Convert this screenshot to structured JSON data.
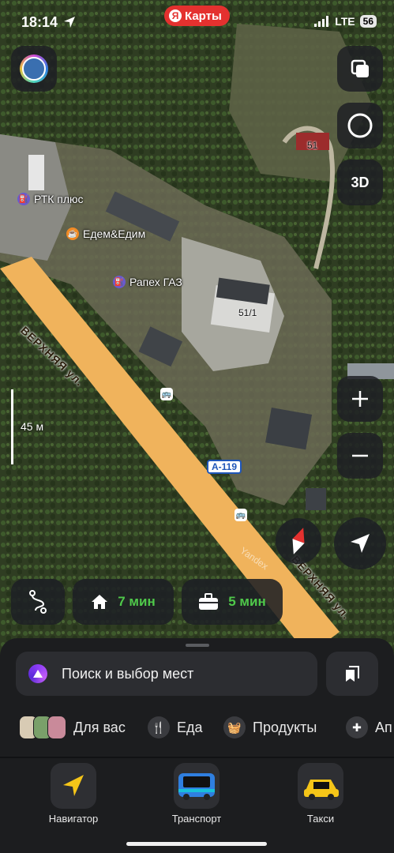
{
  "status_bar": {
    "time": "18:14",
    "network": "LTE",
    "battery": "56"
  },
  "app_badge": {
    "logo": "Я",
    "name": "Карты"
  },
  "map": {
    "pois": [
      {
        "name": "РТК плюс",
        "icon": "fuel-icon"
      },
      {
        "name": "Едем&Едим",
        "icon": "cafe-icon"
      },
      {
        "name": "Рапех ГАЗ",
        "icon": "fuel-icon"
      }
    ],
    "buildings": [
      "51",
      "51/1"
    ],
    "streets": [
      "ВЕРХНЯЯ ул.",
      "ВЕРХНЯЯ ул."
    ],
    "road_shield": "А-119",
    "scale_label": "45 м",
    "watermark": "Yandex"
  },
  "controls": {
    "three_d_label": "3D"
  },
  "quick_routes": {
    "home": {
      "icon": "home-icon",
      "time": "7 мин"
    },
    "work": {
      "icon": "briefcase-icon",
      "time": "5 мин"
    }
  },
  "search": {
    "label": "Поиск и выбор мест"
  },
  "categories": [
    {
      "label": "Для вас"
    },
    {
      "label": "Еда"
    },
    {
      "label": "Продукты"
    },
    {
      "label": "Ап"
    }
  ],
  "tabs": [
    {
      "label": "Навигатор"
    },
    {
      "label": "Транспорт"
    },
    {
      "label": "Такси"
    }
  ],
  "colors": {
    "accent_red": "#e4312f",
    "time_green": "#4fc84a",
    "road": "#f0b35c"
  }
}
